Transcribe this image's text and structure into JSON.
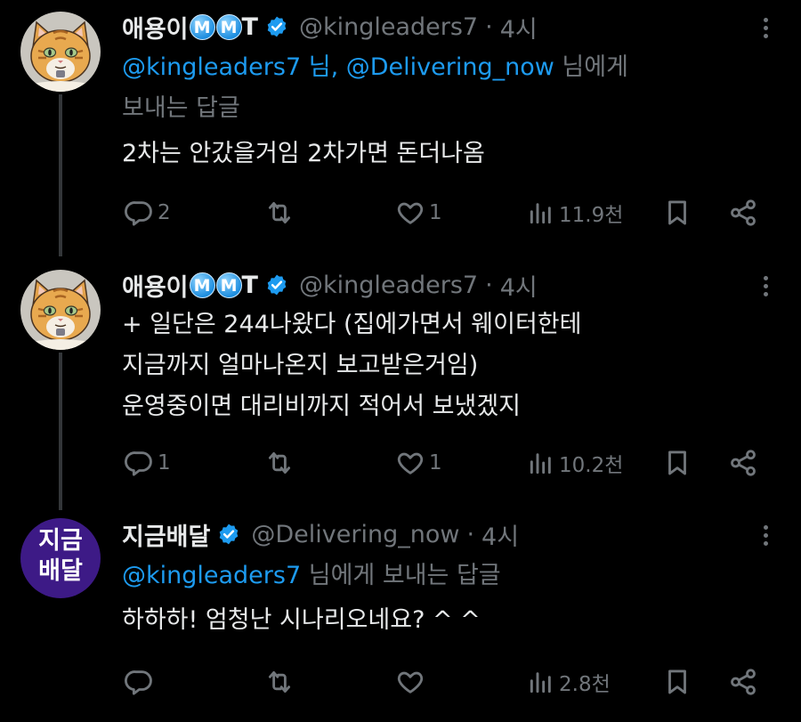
{
  "tweets": [
    {
      "name": "애용이",
      "badge_letters": [
        "M",
        "M"
      ],
      "name_suffix": "T",
      "handle": "@kingleaders7",
      "dot": "·",
      "time": "4시",
      "reply_prefix": "",
      "mentions": [
        "@kingleaders7 님,",
        "@Delivering_now"
      ],
      "reply_suffix": "님에게",
      "reply_line2": "보내는 답글",
      "body_lines": [
        "2차는 안갔을거임 2차가면 돈더나옴"
      ],
      "replies": "2",
      "retweets": "",
      "likes": "1",
      "views": "11.9천"
    },
    {
      "name": "애용이",
      "badge_letters": [
        "M",
        "M"
      ],
      "name_suffix": "T",
      "handle": "@kingleaders7",
      "dot": "·",
      "time": "4시",
      "body_lines": [
        "+ 일단은 244나왔다 (집에가면서 웨이터한테",
        "지금까지 얼마나온지 보고받은거임)",
        "운영중이면 대리비까지 적어서 보냈겠지"
      ],
      "replies": "1",
      "retweets": "",
      "likes": "1",
      "views": "10.2천"
    },
    {
      "name": "지금배달",
      "avatar_text": [
        "지금",
        "배달"
      ],
      "handle": "@Delivering_now",
      "dot": "·",
      "time": "4시",
      "mentions": [
        "@kingleaders7"
      ],
      "reply_suffix": "님에게 보내는 답글",
      "body_lines": [
        "하하하! 엄청난 시나리오네요? ^ ^"
      ],
      "replies": "",
      "retweets": "",
      "likes": "",
      "views": "2.8천"
    }
  ],
  "colors": {
    "background": "#000000",
    "text": "#e7e9ea",
    "muted": "#71767b",
    "link": "#1d9bf0",
    "verified": "#1d9bf0",
    "avatar2_bg": "#3d1a86"
  },
  "icons": [
    "reply-icon",
    "retweet-icon",
    "like-icon",
    "views-icon",
    "bookmark-icon",
    "share-icon",
    "more-icon",
    "verified-icon"
  ]
}
